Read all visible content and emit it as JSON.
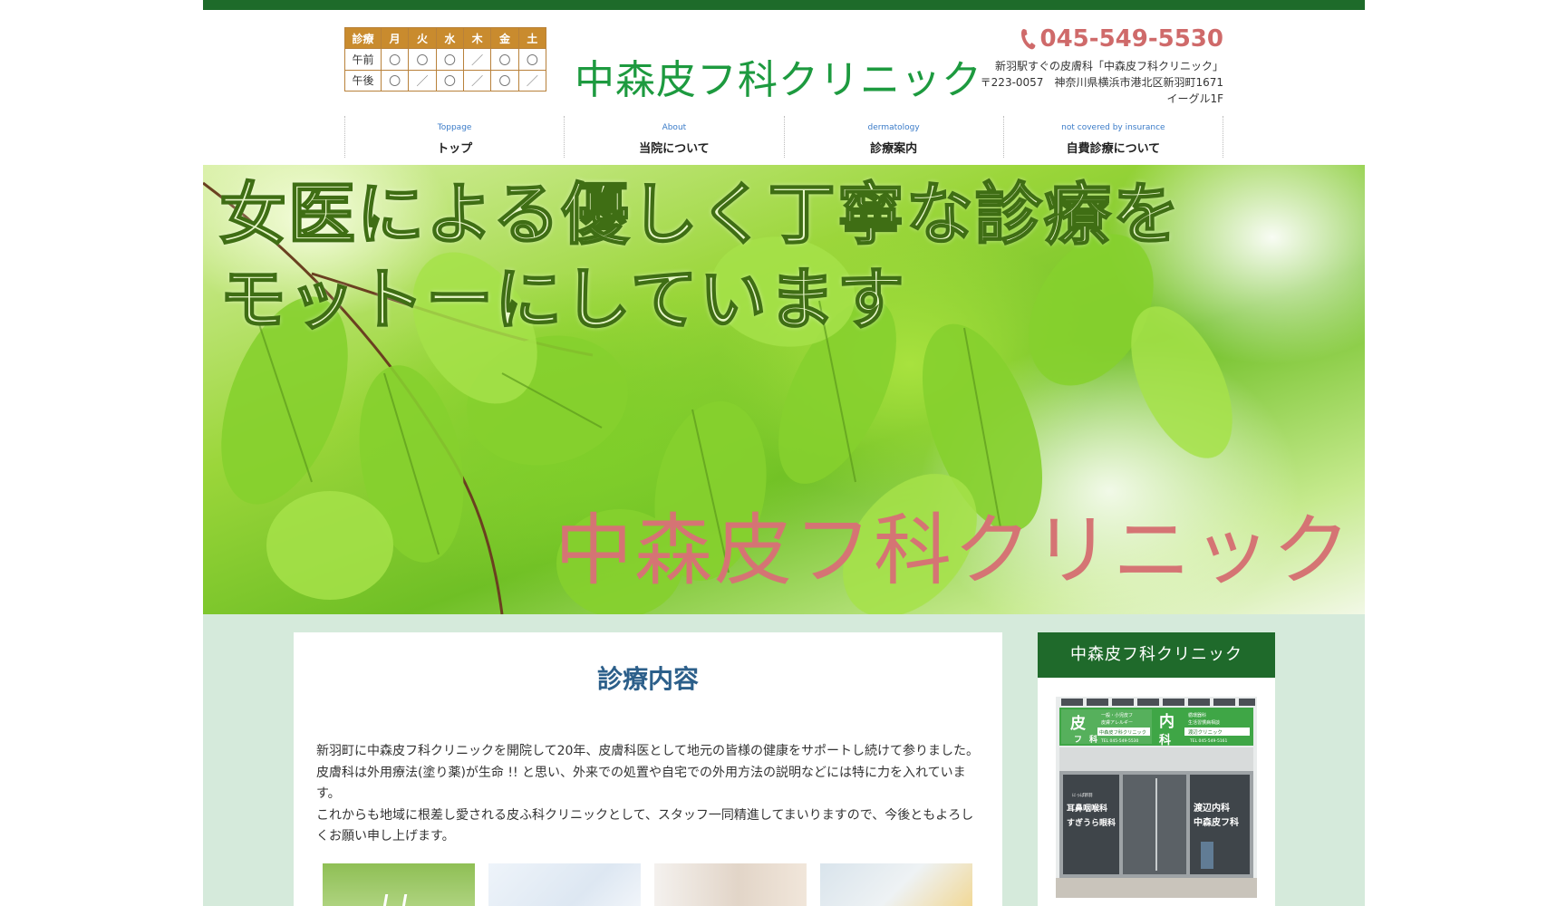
{
  "header": {
    "clinic_name": "中森皮フ科クリニック",
    "phone": "045-549-5530",
    "tagline": "新羽駅すぐの皮膚科「中森皮フ科クリニック」",
    "address_line1": "〒223-0057　神奈川県横浜市港北区新羽町1671",
    "address_line2": "イーグル1F"
  },
  "schedule": {
    "corner": "診療",
    "days": [
      "月",
      "火",
      "水",
      "木",
      "金",
      "土"
    ],
    "rows": [
      {
        "label": "午前",
        "marks": [
          "〇",
          "〇",
          "〇",
          "／",
          "〇",
          "〇"
        ]
      },
      {
        "label": "午後",
        "marks": [
          "〇",
          "／",
          "〇",
          "／",
          "〇",
          "／"
        ]
      }
    ]
  },
  "nav": [
    {
      "en": "Toppage",
      "ja": "トップ"
    },
    {
      "en": "About",
      "ja": "当院について"
    },
    {
      "en": "dermatology",
      "ja": "診療案内"
    },
    {
      "en": "not covered by insurance",
      "ja": "自費診療について"
    }
  ],
  "hero": {
    "line1": "女医による優しく丁寧な診療を",
    "line2": "モットーにしています",
    "clinic_name": "中森皮フ科クリニック"
  },
  "main": {
    "title": "診療内容",
    "paragraph1": "新羽町に中森皮フ科クリニックを開院して20年、皮膚科医として地元の皆様の健康をサポートし続けて参りました。皮膚科は外用療法(塗り薬)が生命 !! と思い、外来での処置や自宅での外用方法の説明などには特に力を入れています。",
    "paragraph2": "これからも地域に根差し愛される皮ふ科クリニックとして、スタッフ一同精進してまいりますので、今後ともよろしくお願い申し上げます。"
  },
  "sidebar": {
    "title": "中森皮フ科クリニック",
    "sign_left_top": "皮",
    "sign_left_mid": "フ",
    "sign_left_bottom": "科",
    "sign_right_top": "内",
    "sign_right_bottom": "科",
    "sign_text_a": "一般・小児皮フ",
    "sign_text_b": "皮膚アレルギー",
    "sign_text_c": "中森皮フ科クリニック",
    "sign_tel_left": "TEL 045-549-5530",
    "sign_text_d": "循環器科",
    "sign_text_e": "生活習慣病相談",
    "sign_text_f": "渡辺クリニック",
    "sign_tel_right": "TEL 045-549-5161",
    "door_left_small": "にっぱ新羽",
    "door_left_1": "耳鼻咽喉科",
    "door_left_2": "すぎうら眼科",
    "door_right_1": "渡辺内科",
    "door_right_2": "中森皮フ科"
  },
  "colors": {
    "top_bar": "#1e6b2a",
    "logo_green": "#1d9a3f",
    "phone_pink": "#cf6a6a",
    "content_band": "#d5eadb",
    "side_header": "#1f6a2b",
    "title_blue": "#2c5f8a"
  }
}
